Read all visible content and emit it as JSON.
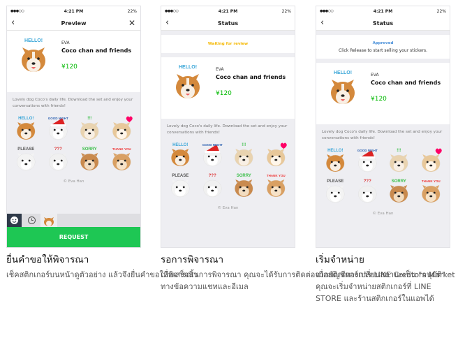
{
  "status": {
    "time": "4:21 PM",
    "battery": "22%",
    "signal": "●●●○○"
  },
  "panels": [
    {
      "nav_title": "Preview",
      "creator": "EVA",
      "product_name": "Coco chan and friends",
      "price": "¥120",
      "description": "Lovely dog Coco's daily life. Download the set and enjoy your conversations with friends!",
      "credit": "© Eva Han",
      "request_label": "REQUEST",
      "caption_title": "ยื่นคำขอให้พิจารณา",
      "caption_body": "เช็คสติกเกอร์บนหน้าดูตัวอย่าง แล้วจึงยื่นคำขอให้พิจารณา"
    },
    {
      "nav_title": "Status",
      "banner_text": "Waiting for review",
      "creator": "EVA",
      "product_name": "Coco chan and friends",
      "price": "¥120",
      "description": "Lovely dog Coco's daily life. Download the set and enjoy your conversations with friends!",
      "credit": "© Eva Han",
      "caption_title": "รอการพิจารณา",
      "caption_body": "เมื่อเสร็จสิ้นการพิจารณา คุณจะได้รับการติดต่อจากบัญชีทางการ LINE Creators Market ทางข้อความแชทและอีเมล"
    },
    {
      "nav_title": "Status",
      "banner_status": "Approved",
      "banner_text": "Click Release to start selling your stickers.",
      "creator": "EVA",
      "product_name": "Coco chan and friends",
      "price": "¥120",
      "description": "Lovely dog Coco's daily life. Download the set and enjoy your conversations with friends!",
      "credit": "© Eva Han",
      "caption_title": "เริ่มจำหน่าย",
      "caption_body": "เมื่อสติกเกอร์เปลี่ยนสถานะเป็น \"อนุมัติ\" คุณจะเริ่มจำหน่ายสติกเกอร์ที่ LINE STORE และร้านสติกเกอร์ในแอพได้"
    }
  ],
  "stickers": [
    {
      "name": "hello-corgi-sticker",
      "label": "HELLO!"
    },
    {
      "name": "good-night-corgi-sticker",
      "label": "GOOD NIGHT"
    },
    {
      "name": "surprised-dog-sticker",
      "label": "!!!"
    },
    {
      "name": "love-dog-sticker",
      "label": ""
    },
    {
      "name": "please-dog-sticker",
      "label": "PLEASE"
    },
    {
      "name": "shocked-dog-sticker",
      "label": "???"
    },
    {
      "name": "sorry-dog-sticker",
      "label": "SORRY"
    },
    {
      "name": "thank-you-dog-sticker",
      "label": "THANK YOU"
    }
  ],
  "hero_label": "HELLO!",
  "colors": {
    "accent_green": "#00b900",
    "request_green": "#1ec754",
    "waiting_yellow": "#f5b800",
    "approved_blue": "#4a90d9"
  }
}
